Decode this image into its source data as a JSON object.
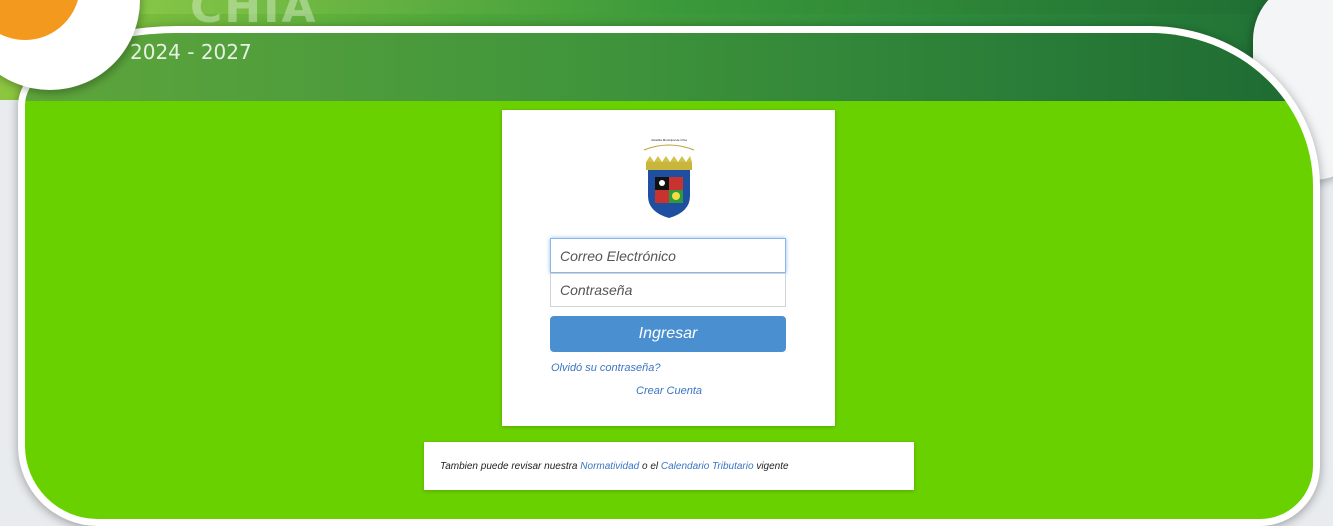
{
  "header": {
    "logo_text": "CHIA",
    "years": "2024 - 2027"
  },
  "login": {
    "email_placeholder": "Correo Electrónico",
    "password_placeholder": "Contraseña",
    "submit_label": "Ingresar",
    "forgot_label": "Olvidó su contraseña?",
    "create_account_label": "Crear Cuenta",
    "crest_motto": "Alcaldía Municipal de Chía"
  },
  "footer": {
    "text_before": "Tambien puede revisar nuestra",
    "link_normatividad": "Normatividad",
    "text_middle": "o el",
    "link_calendario": "Calendario Tributario",
    "text_after": "vigente"
  },
  "colors": {
    "panel_green": "#6ad100",
    "button_blue": "#4a8fd0",
    "link_blue": "#3a75c4",
    "accent_orange": "#f39a1e"
  }
}
